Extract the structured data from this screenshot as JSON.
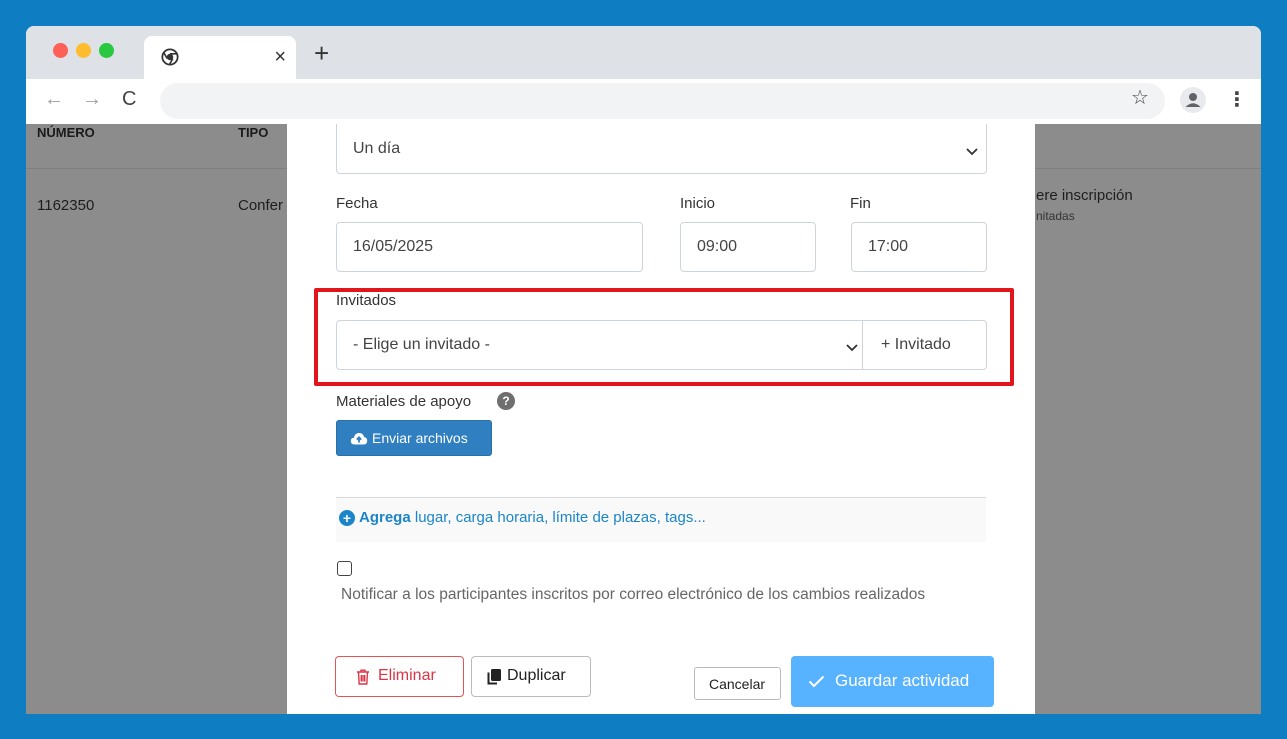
{
  "browser": {
    "tab": {
      "title": "",
      "close_icon": "×"
    },
    "new_tab_icon": "+",
    "nav": {
      "back": "←",
      "forward": "→",
      "reload": "C"
    },
    "omnibox_value": "",
    "star_icon": "☆",
    "menu_icon": "⋮"
  },
  "background": {
    "headers": [
      "NÚMERO",
      "TIPO"
    ],
    "row": {
      "numero": "1162350",
      "tipo": "Confer",
      "right_title": "ere inscripción",
      "right_sub": "nitadas"
    }
  },
  "modal": {
    "duration_select": "Un día",
    "date": {
      "label": "Fecha",
      "value": "16/05/2025"
    },
    "start": {
      "label": "Inicio",
      "value": "09:00"
    },
    "end": {
      "label": "Fin",
      "value": "17:00"
    },
    "guests": {
      "label": "Invitados",
      "select_value": "- Elige un invitado -",
      "add_button": "+ Invitado"
    },
    "materials": {
      "label": "Materiales de apoyo",
      "help_icon": "?",
      "upload_button": "Enviar archivos"
    },
    "add_more": {
      "strong": "Agrega",
      "rest": " lugar, carga horaria, límite de plazas, tags..."
    },
    "notify_label": "Notificar a los participantes inscritos por correo electrónico de los cambios realizados",
    "buttons": {
      "delete": "Eliminar",
      "duplicate": "Duplicar",
      "cancel": "Cancelar",
      "save": "Guardar actividad"
    }
  },
  "colors": {
    "page_bg": "#0e7dc1",
    "highlight": "#e0161c",
    "primary": "#57b2ff",
    "danger": "#dc3545",
    "link": "#1c85c9"
  }
}
